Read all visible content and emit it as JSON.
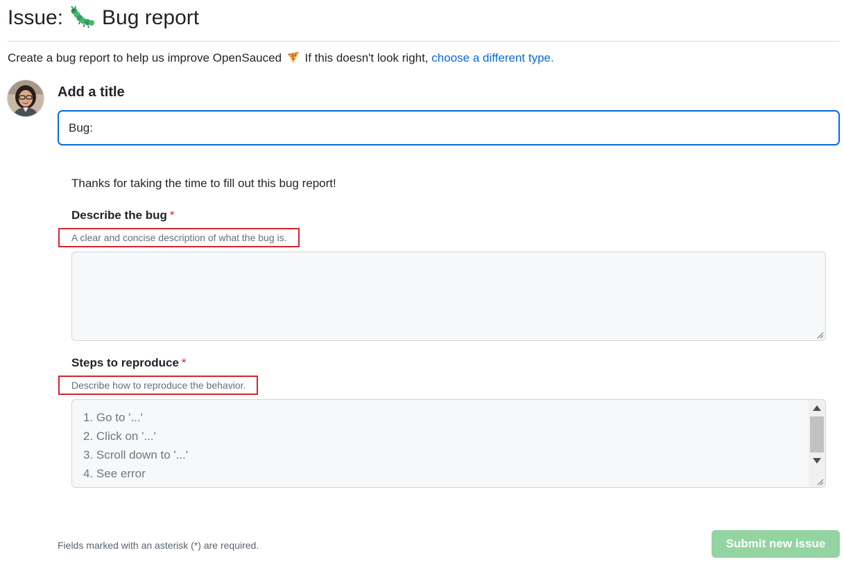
{
  "page": {
    "title_prefix": "Issue:",
    "title_emoji_icon": "caterpillar-bug-icon",
    "title_text": "Bug report"
  },
  "intro": {
    "text": "Create a bug report to help us improve OpenSauced",
    "emoji_icon": "pizza-icon",
    "text2": " If this doesn't look right, ",
    "link": "choose a different type."
  },
  "title_section": {
    "label": "Add a title",
    "input_value": "Bug:"
  },
  "form": {
    "thanks": "Thanks for taking the time to fill out this bug report!",
    "describe": {
      "label": "Describe the bug",
      "required_mark": "*",
      "hint": "A clear and concise description of what the bug is.",
      "value": ""
    },
    "steps": {
      "label": "Steps to reproduce",
      "required_mark": "*",
      "hint": "Describe how to reproduce the behavior.",
      "lines": [
        "1. Go to '...'",
        "2. Click on '...'",
        "3. Scroll down to '...'",
        "4. See error"
      ]
    }
  },
  "footer": {
    "note": "Fields marked with an asterisk (*) are required.",
    "submit_label": "Submit new issue"
  },
  "colors": {
    "link": "#0969da",
    "required": "#cf222e",
    "highlight_box": "#d1242f",
    "submit_disabled": "#94d3a2"
  }
}
